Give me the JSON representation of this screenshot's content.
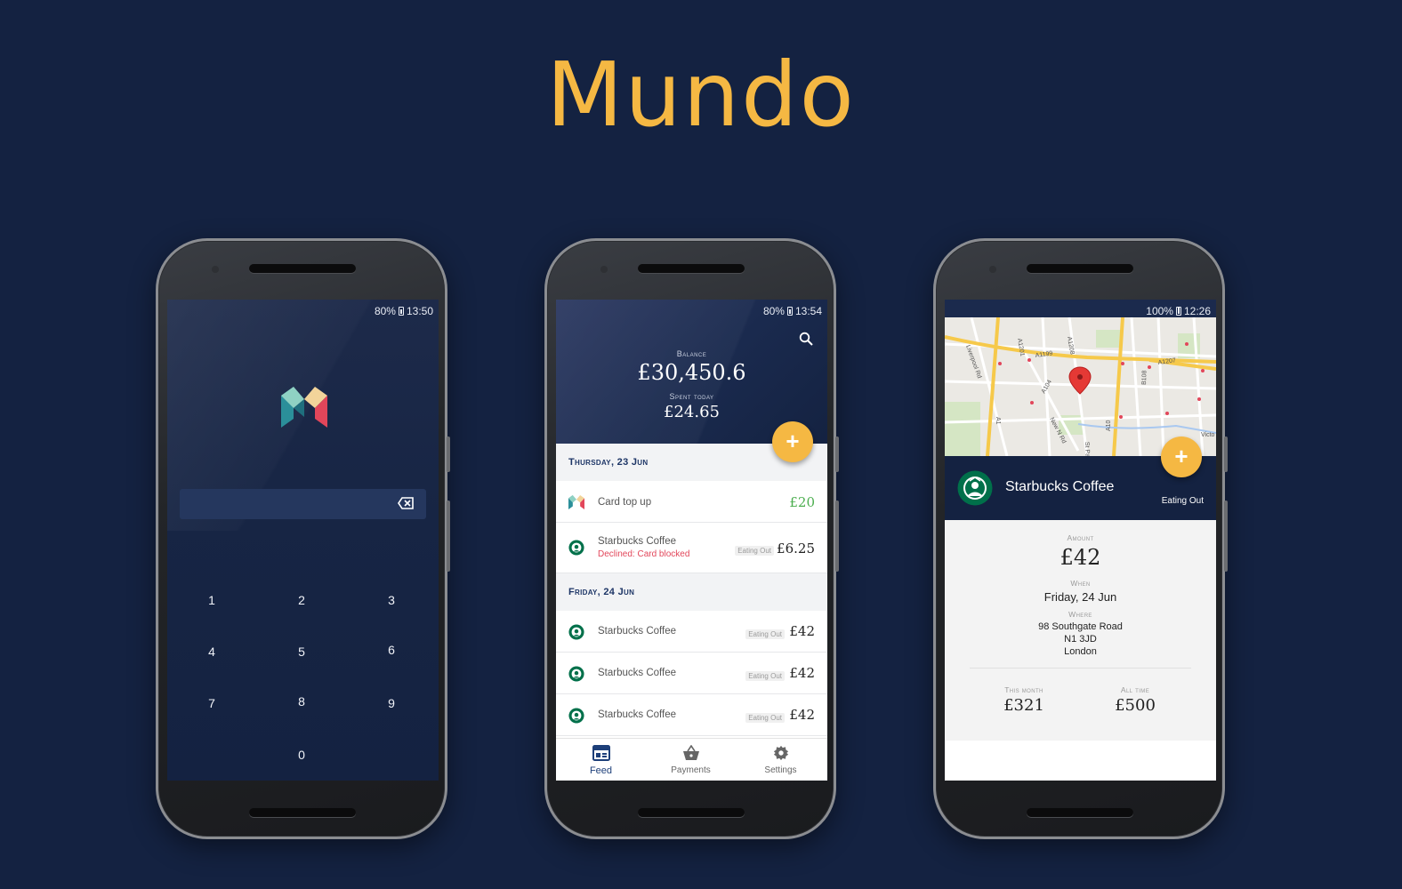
{
  "app_title": "Mundo",
  "colors": {
    "background": "#142241",
    "accent": "#f5b843",
    "declined": "#e2465a",
    "credit": "#4cae4f"
  },
  "phone1": {
    "status": {
      "battery": "80%",
      "time": "13:50"
    },
    "logo": "mondo-m-logo",
    "pin_field": {
      "value": ""
    },
    "keypad": [
      "1",
      "2",
      "3",
      "4",
      "5",
      "6",
      "7",
      "8",
      "9",
      "0"
    ]
  },
  "phone2": {
    "status": {
      "battery": "80%",
      "time": "13:54"
    },
    "balance_label": "Balance",
    "balance_value": "£30,450.6",
    "spent_label": "Spent today",
    "spent_value": "£24.65",
    "fab_label": "+",
    "groups": [
      {
        "date": "Thursday, 23 Jun",
        "items": [
          {
            "name": "Card top up",
            "sub": "",
            "category": "",
            "amount": "£20",
            "icon": "mondo-m-icon",
            "credit": true
          },
          {
            "name": "Starbucks Coffee",
            "sub": "Declined: Card blocked",
            "category": "Eating Out",
            "amount": "£6.25",
            "icon": "starbucks-icon",
            "credit": false
          }
        ]
      },
      {
        "date": "Friday, 24 Jun",
        "items": [
          {
            "name": "Starbucks Coffee",
            "sub": "",
            "category": "Eating Out",
            "amount": "£42",
            "icon": "starbucks-icon",
            "credit": false
          },
          {
            "name": "Starbucks Coffee",
            "sub": "",
            "category": "Eating Out",
            "amount": "£42",
            "icon": "starbucks-icon",
            "credit": false
          },
          {
            "name": "Starbucks Coffee",
            "sub": "",
            "category": "Eating Out",
            "amount": "£42",
            "icon": "starbucks-icon",
            "credit": false
          }
        ]
      }
    ],
    "nav": [
      {
        "label": "Feed",
        "icon": "feed-icon",
        "active": true
      },
      {
        "label": "Payments",
        "icon": "basket-icon",
        "active": false
      },
      {
        "label": "Settings",
        "icon": "gear-icon",
        "active": false
      }
    ]
  },
  "phone3": {
    "status": {
      "battery": "100%",
      "time": "12:26"
    },
    "map_labels": [
      "A1201",
      "A1199",
      "A1208",
      "A1207",
      "A104",
      "A1",
      "A10",
      "B108",
      "Liverpool Rd",
      "New N Rd",
      "St Pauls Rd",
      "Victo"
    ],
    "fab_label": "+",
    "merchant": "Starbucks Coffee",
    "category": "Eating Out",
    "amount_label": "Amount",
    "amount": "£42",
    "when_label": "When",
    "when": "Friday, 24 Jun",
    "where_label": "Where",
    "where": [
      "98 Southgate Road",
      "N1 3JD",
      "London"
    ],
    "this_month_label": "This month",
    "this_month": "£321",
    "all_time_label": "All time",
    "all_time": "£500"
  }
}
